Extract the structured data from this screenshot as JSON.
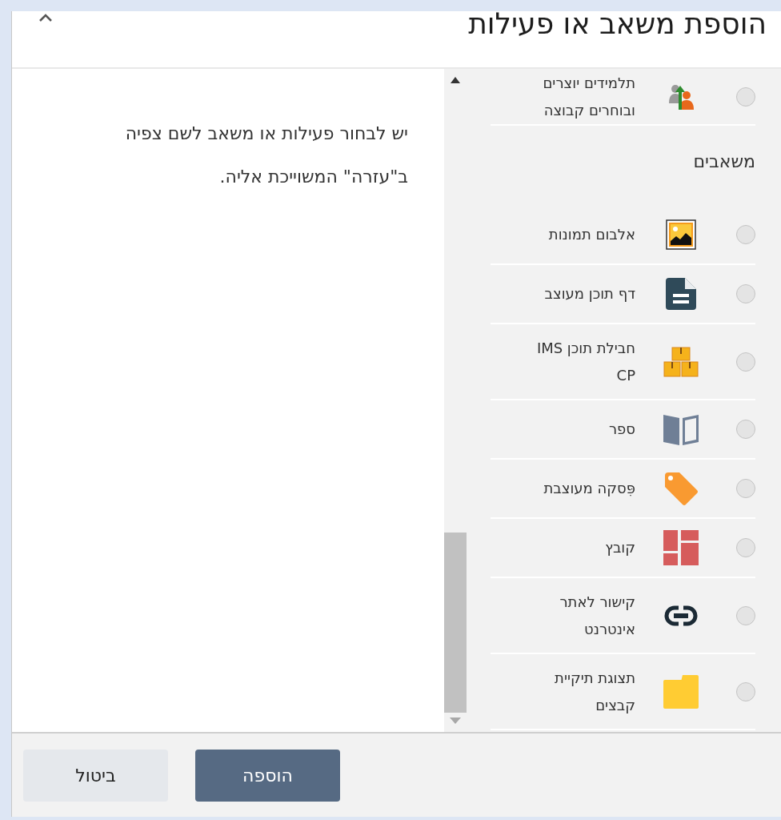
{
  "dialog": {
    "title": "הוספת משאב או פעילות"
  },
  "help_text": "יש לבחור פעילות או משאב לשם צפיה ב\"עזרה\" המשוייכת אליה.",
  "sections": [
    {
      "items": [
        {
          "label": "תלמידים יוצרים ובוחרים קבוצה",
          "kind": "group",
          "selected": false
        }
      ]
    },
    {
      "heading": "משאבים",
      "items": [
        {
          "label": "אלבום תמונות",
          "kind": "album",
          "selected": false
        },
        {
          "label": "דף תוכן מעוצב",
          "kind": "page",
          "selected": false
        },
        {
          "label": "חבילת תוכן IMS CP",
          "kind": "package",
          "selected": false
        },
        {
          "label": "ספר",
          "kind": "book",
          "selected": false
        },
        {
          "label": "פִּסקה מעוצבת",
          "kind": "label",
          "selected": false
        },
        {
          "label": "קובץ",
          "kind": "file",
          "selected": false
        },
        {
          "label": "קישור לאתר אינטרנט",
          "kind": "url",
          "selected": false
        },
        {
          "label": "תצוגת תיקיית קבצים",
          "kind": "folder",
          "selected": false
        }
      ]
    }
  ],
  "buttons": [
    {
      "label": "הוספה",
      "kind": "primary"
    },
    {
      "label": "ביטול",
      "kind": "secondary"
    }
  ]
}
